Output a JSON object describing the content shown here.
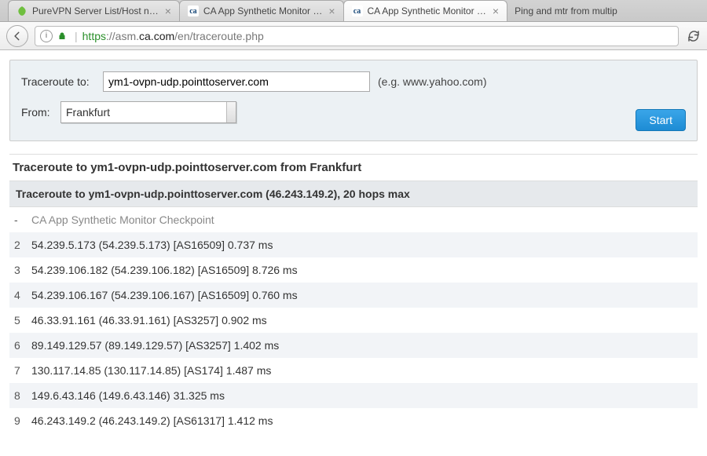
{
  "tabs": [
    {
      "title": "PureVPN Server List/Host n…",
      "active": false,
      "icon": "purevpn"
    },
    {
      "title": "CA App Synthetic Monitor …",
      "active": false,
      "icon": "ca"
    },
    {
      "title": "CA App Synthetic Monitor …",
      "active": true,
      "icon": "ca"
    },
    {
      "title": "Ping and mtr from multip",
      "active": false,
      "icon": "none",
      "plain": true
    }
  ],
  "url": {
    "scheme": "https",
    "host": "asm.ca.com",
    "path": "/en/traceroute.php"
  },
  "form": {
    "traceroute_label": "Traceroute to:",
    "traceroute_value": "ym1-ovpn-udp.pointtoserver.com",
    "hint": "(e.g. www.yahoo.com)",
    "from_label": "From:",
    "from_value": "Frankfurt",
    "start_label": "Start"
  },
  "results": {
    "title": "Traceroute to ym1-ovpn-udp.pointtoserver.com from Frankfurt",
    "subtitle": "Traceroute to ym1-ovpn-udp.pointtoserver.com (46.243.149.2), 20 hops max",
    "hops": [
      {
        "idx": "-",
        "text": "CA App Synthetic Monitor Checkpoint",
        "first": true
      },
      {
        "idx": "2",
        "text": "54.239.5.173 (54.239.5.173) [AS16509] 0.737 ms"
      },
      {
        "idx": "3",
        "text": "54.239.106.182 (54.239.106.182) [AS16509] 8.726 ms"
      },
      {
        "idx": "4",
        "text": "54.239.106.167 (54.239.106.167) [AS16509] 0.760 ms"
      },
      {
        "idx": "5",
        "text": "46.33.91.161 (46.33.91.161) [AS3257] 0.902 ms"
      },
      {
        "idx": "6",
        "text": "89.149.129.57 (89.149.129.57) [AS3257] 1.402 ms"
      },
      {
        "idx": "7",
        "text": "130.117.14.85 (130.117.14.85) [AS174] 1.487 ms"
      },
      {
        "idx": "8",
        "text": "149.6.43.146 (149.6.43.146) 31.325 ms"
      },
      {
        "idx": "9",
        "text": "46.243.149.2 (46.243.149.2) [AS61317] 1.412 ms"
      }
    ]
  }
}
